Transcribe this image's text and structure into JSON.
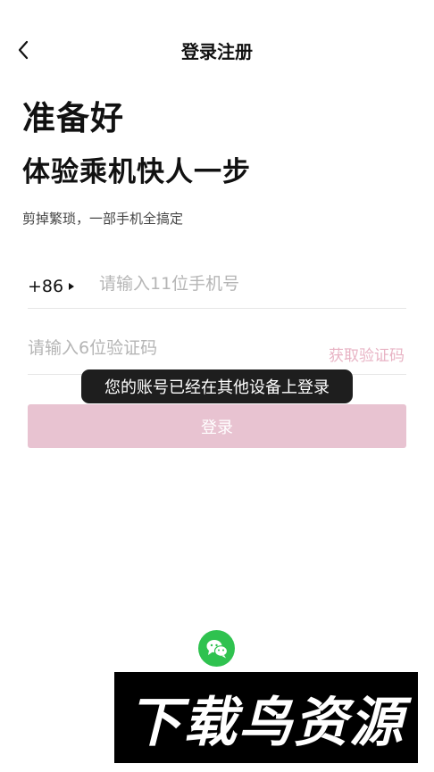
{
  "header": {
    "title": "登录注册",
    "back_icon": "chevron-left-icon"
  },
  "hero": {
    "headline_line1": "准备好",
    "headline_line2": "体验乘机快人一步",
    "subtitle": "剪掉繁琐，一部手机全搞定"
  },
  "form": {
    "country_code": "+86",
    "phone_placeholder": "请输入11位手机号",
    "code_placeholder": "请输入6位验证码",
    "get_code_label": "获取验证码",
    "login_label": "登录"
  },
  "toast": {
    "message": "您的账号已经在其他设备上登录"
  },
  "social": {
    "wechat_icon": "wechat-icon"
  },
  "watermark": {
    "text": "下载鸟资源"
  },
  "colors": {
    "login_button_bg": "#e8c3d1",
    "get_code_text": "#e8b3c4",
    "wechat_green": "#2fc24f",
    "toast_bg": "#1e1e1e"
  }
}
